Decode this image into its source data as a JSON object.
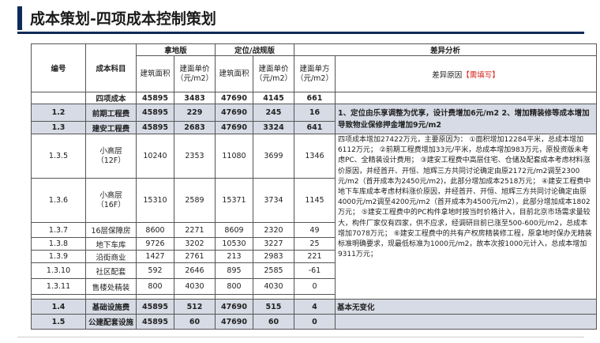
{
  "page": {
    "title": "成本策划-四项成本控制策划"
  },
  "table": {
    "headers": {
      "code": "编号",
      "subject": "成本科目",
      "group_land": "拿地版",
      "group_target": "定位/战规版",
      "group_diff": "差异分析",
      "area": "建筑面积",
      "unit_price": "建面单价（元/m2）",
      "area2": "建筑面积",
      "unit_price2": "建面单价（元/m2）",
      "diff_unit": "建面单方（元/m2）",
      "reason_prefix": "差异原因",
      "reason_tag": "【需填写】"
    },
    "rows": [
      {
        "code": "",
        "subject": "四项成本",
        "a1": "45895",
        "p1": "3483",
        "a2": "47690",
        "p2": "4145",
        "d": "661"
      },
      {
        "code": "1.2",
        "subject": "前期工程费",
        "a1": "45895",
        "p1": "229",
        "a2": "47690",
        "p2": "245",
        "d": "16"
      },
      {
        "code": "1.3",
        "subject": "建安工程费",
        "a1": "45895",
        "p1": "2683",
        "a2": "47690",
        "p2": "3324",
        "d": "641"
      },
      {
        "code": "1.3.5",
        "subject": "小高层（12F）",
        "a1": "10240",
        "p1": "2353",
        "a2": "11080",
        "p2": "3699",
        "d": "1346"
      },
      {
        "code": "1.3.6",
        "subject": "小高层（16F）",
        "a1": "15310",
        "p1": "2589",
        "a2": "15371",
        "p2": "3734",
        "d": "1145"
      },
      {
        "code": "1.3.7",
        "subject": "16层保障房",
        "a1": "8600",
        "p1": "2271",
        "a2": "8609",
        "p2": "2320",
        "d": "49"
      },
      {
        "code": "1.3.8",
        "subject": "地下车库",
        "a1": "9726",
        "p1": "3202",
        "a2": "10530",
        "p2": "3227",
        "d": "25"
      },
      {
        "code": "1.3.9",
        "subject": "沿街商业",
        "a1": "1427",
        "p1": "2761",
        "a2": "213",
        "p2": "2983",
        "d": "221"
      },
      {
        "code": "1.3.10",
        "subject": "社区配套",
        "a1": "592",
        "p1": "2646",
        "a2": "895",
        "p2": "2585",
        "d": "-61"
      },
      {
        "code": "1.3.11",
        "subject": "售楼处精装",
        "a1": "800",
        "a2": "800",
        "p1": "4030",
        "p2": "4030",
        "d": "0"
      },
      {
        "code": "1.4",
        "subject": "基础设施费",
        "a1": "45895",
        "p1": "512",
        "a2": "47690",
        "p2": "515",
        "d": "4"
      },
      {
        "code": "1.5",
        "subject": "公建配套设施",
        "a1": "45895",
        "p1": "60",
        "a2": "47690",
        "p2": "60",
        "d": "0"
      }
    ],
    "analysis_top": "1、定位由乐享调整为优享，设计费增加6元/m2\n2、增加精装修等成本增加导致物业保修押金增加9元/m2",
    "analysis_main": "四项成本增加27422万元，主要原因为：\n①面积增加12284平米，总成本增加6112万元；\n②前期工程费增加33元/平米，总成本增加983万元，原投资版未考虑PC、全精装设计费用；\n③建安工程费中高层住宅、仓储及配套成本考虑材料涨价原因，并经首开、开恒、旭辉三方共同讨论确定由原2172元/m2调至2300元/m2（首开成本为2450元/m2)，此部分增加成本2518万元；\n④建安工程费中地下车库成本考虑材料涨价原因，并经首开、开恒、旭辉三方共同讨论确定由原4000元/m2调至4200元/m2（首开成本为4500元/m2），此部分增加成本1802万元；\n⑤建安工程费中的PC构件拿地时按当时价格计入，目前北京市场需求量较大，构件厂家仅有四家，供不应求，经调研目前已涨至500-600元/m2，总成本增加7078万元；\n⑥建安工程费中的共有产权房精装修工程，原拿地时保办无精装标准明确要求，现最低标准为1000元/m2，故本次按1000元计入，总成本增加9311万元；",
    "analysis_infra": "基本无变化"
  },
  "colors": {
    "title_rule": "#0d2c5a",
    "highlight_row": "#d7dbe5",
    "required_tag": "#d6231c"
  }
}
